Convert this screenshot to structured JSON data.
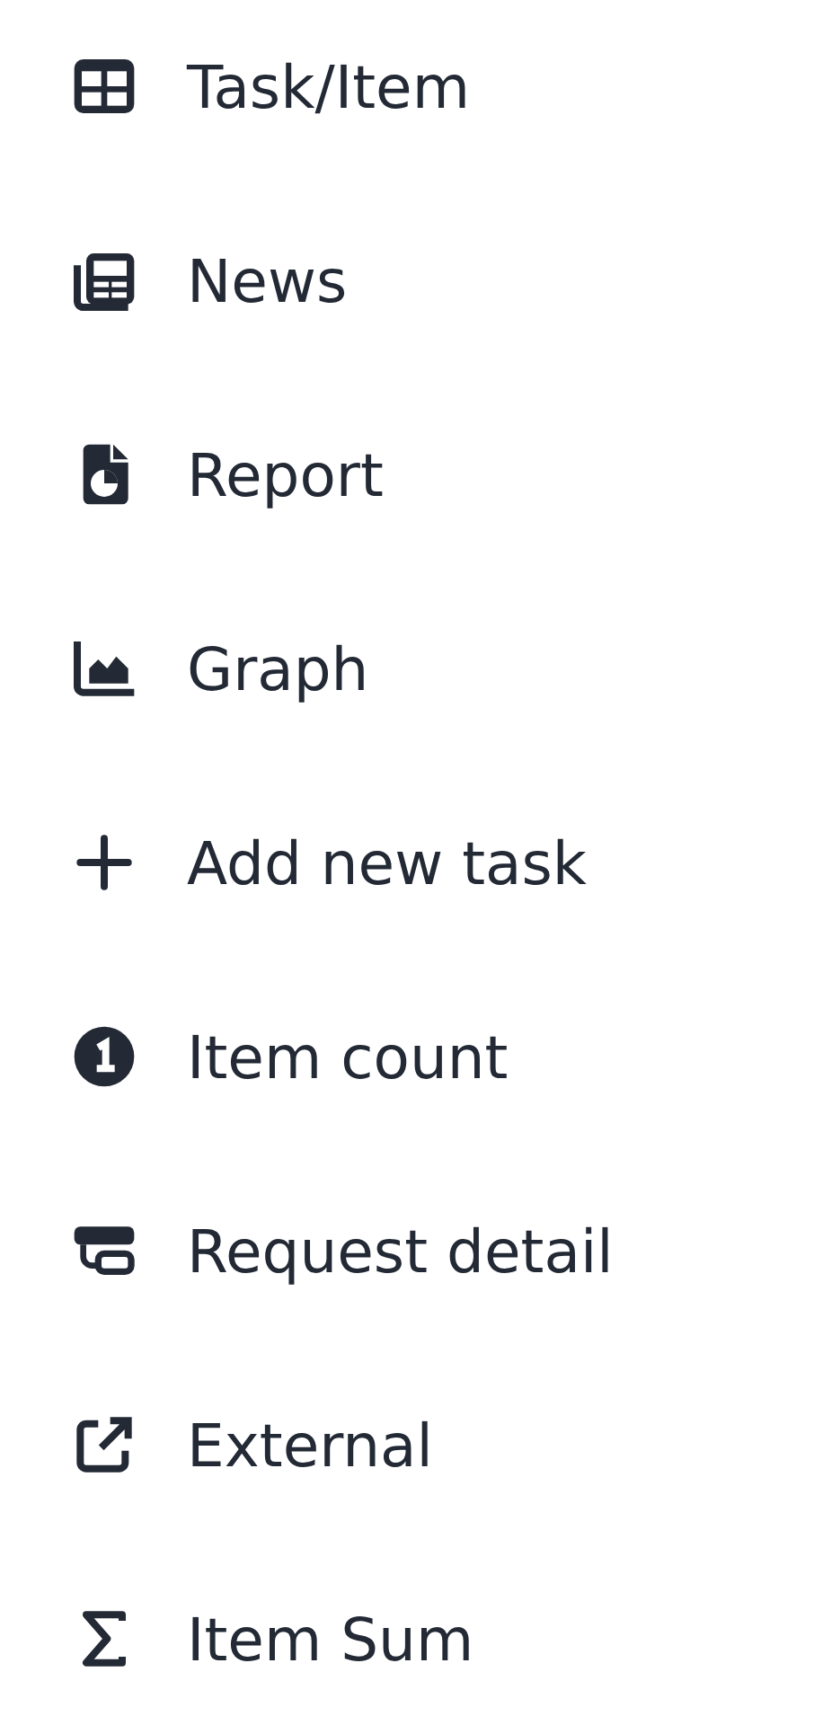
{
  "menu": {
    "items": [
      {
        "kind": "table",
        "label": "Task/Item"
      },
      {
        "kind": "news",
        "label": "News"
      },
      {
        "kind": "report",
        "label": "Report"
      },
      {
        "kind": "graph",
        "label": "Graph"
      },
      {
        "kind": "add",
        "label": "Add new task"
      },
      {
        "kind": "count",
        "label": "Item count"
      },
      {
        "kind": "request",
        "label": "Request detail"
      },
      {
        "kind": "external",
        "label": "External"
      },
      {
        "kind": "sum",
        "label": "Item Sum"
      }
    ]
  }
}
